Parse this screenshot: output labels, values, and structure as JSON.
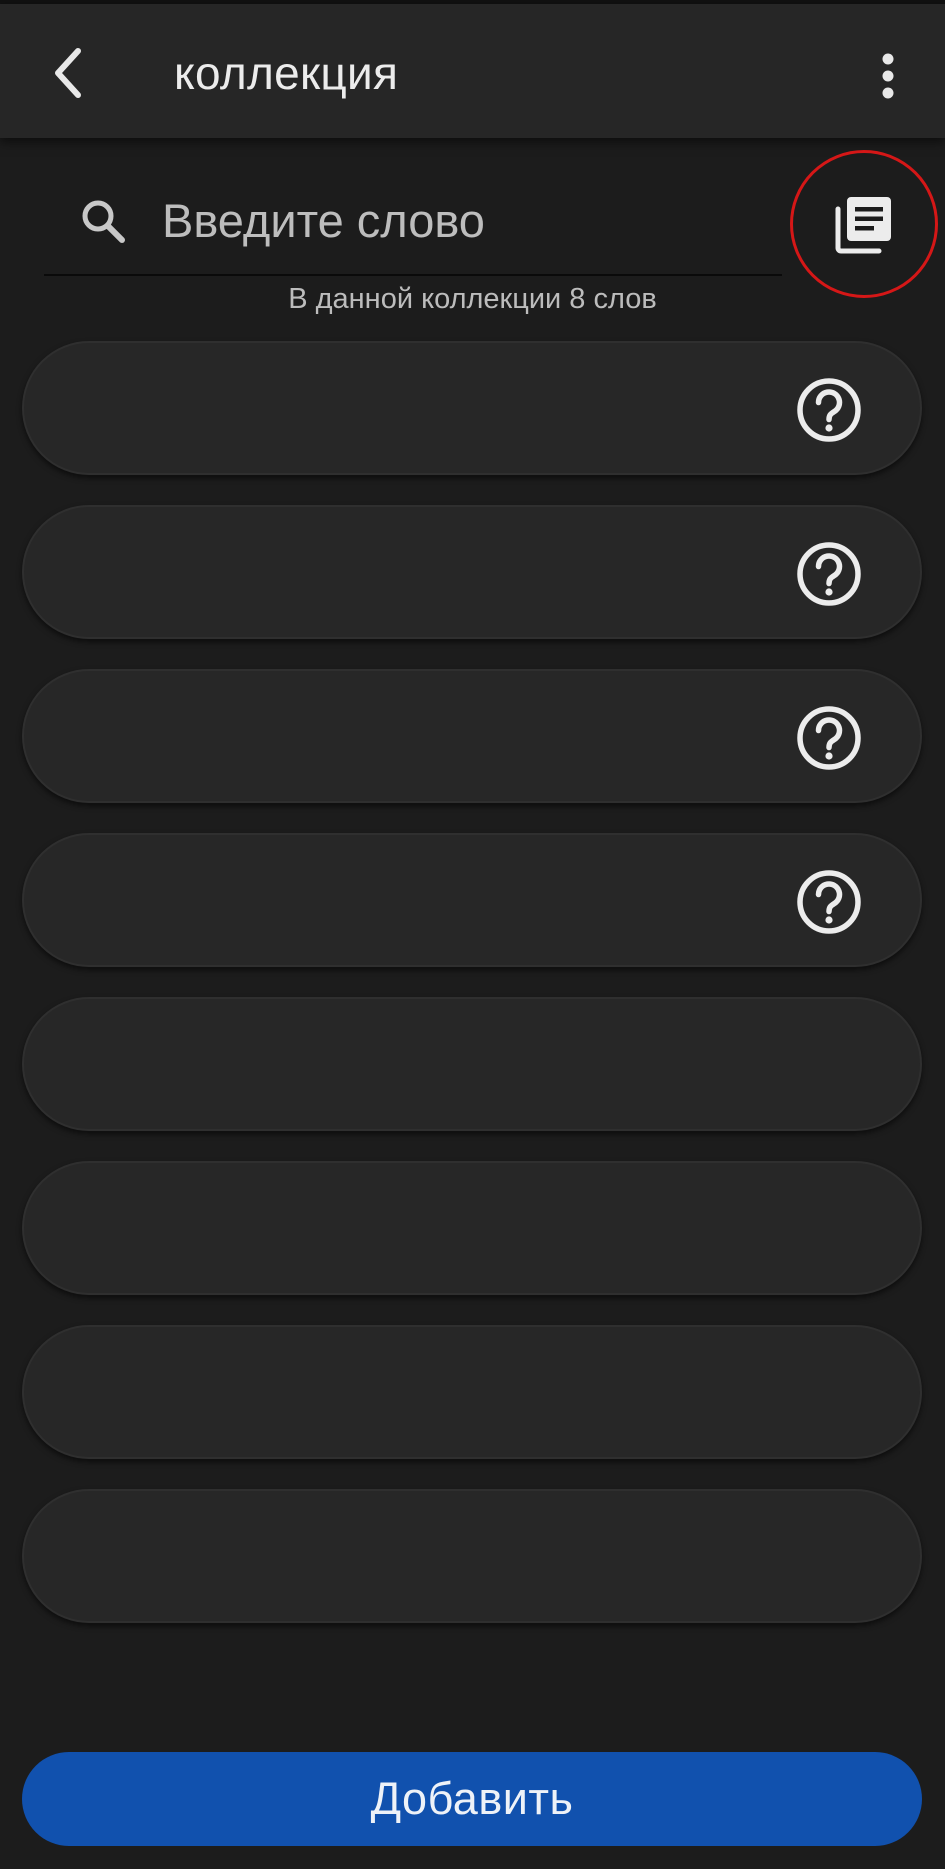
{
  "app_bar": {
    "title": "коллекция",
    "back_icon": "chevron-left-icon",
    "menu_icon": "more-vertical-icon"
  },
  "search": {
    "placeholder": "Введите слово",
    "value": "",
    "icon": "search-icon"
  },
  "collections_button": {
    "icon": "library-books-icon",
    "highlight_color": "#d51717"
  },
  "word_count_text": "В данной коллекции 8 слов",
  "words": [
    {
      "text": "",
      "has_help_icon": true
    },
    {
      "text": "",
      "has_help_icon": true
    },
    {
      "text": "",
      "has_help_icon": true
    },
    {
      "text": "",
      "has_help_icon": true
    },
    {
      "text": "",
      "has_help_icon": false
    },
    {
      "text": "",
      "has_help_icon": false
    },
    {
      "text": "",
      "has_help_icon": false
    },
    {
      "text": "",
      "has_help_icon": false
    }
  ],
  "add_button": {
    "label": "Добавить",
    "color": "#1151ae"
  },
  "colors": {
    "background": "#1c1c1c",
    "app_bar": "#262626",
    "item": "#272727"
  }
}
